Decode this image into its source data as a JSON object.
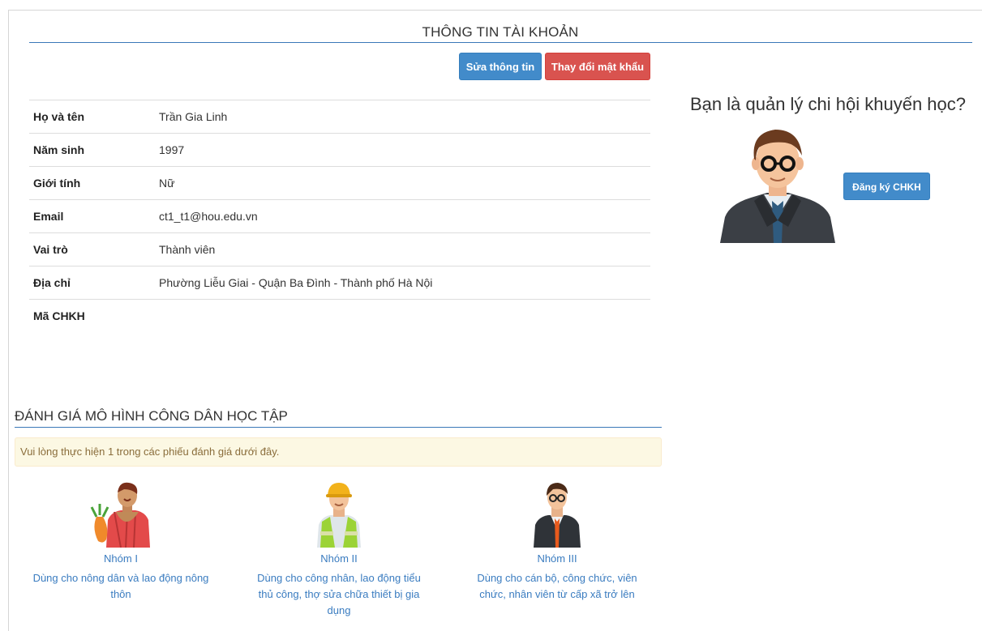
{
  "account": {
    "title": "THÔNG TIN TÀI KHOẢN",
    "edit_button": "Sửa thông tin",
    "change_password_button": "Thay đổi mật khẩu",
    "fields": [
      {
        "label": "Họ và tên",
        "value": "Trần Gia Linh"
      },
      {
        "label": "Năm sinh",
        "value": "1997"
      },
      {
        "label": "Giới tính",
        "value": "Nữ"
      },
      {
        "label": "Email",
        "value": "ct1_t1@hou.edu.vn"
      },
      {
        "label": "Vai trò",
        "value": "Thành viên"
      },
      {
        "label": "Địa chỉ",
        "value": "Phường Liễu Giai - Quận Ba Đình - Thành phố Hà Nội"
      },
      {
        "label": "Mã CHKH",
        "value": ""
      }
    ]
  },
  "sidebar": {
    "question": "Bạn là quản lý chi hội khuyến học?",
    "register_button": "Đăng ký CHKH"
  },
  "evaluation": {
    "title": "ĐÁNH GIÁ MÔ HÌNH CÔNG DÂN HỌC TẬP",
    "notice": "Vui lòng thực hiện 1 trong các phiếu đánh giá dưới đây.",
    "groups": [
      {
        "name": "Nhóm I",
        "line1": "Dùng cho nông dân và lao động nông",
        "line2": "thôn",
        "line3": "",
        "icon": "farmer-icon"
      },
      {
        "name": "Nhóm II",
        "line1": "Dùng cho công nhân, lao động tiểu",
        "line2": "thủ công, thợ sửa chữa thiết bị gia",
        "line3": "dụng",
        "icon": "worker-icon"
      },
      {
        "name": "Nhóm III",
        "line1": "Dùng cho cán bộ, công chức, viên",
        "line2": "chức, nhân viên từ cấp xã trở lên",
        "line3": "",
        "icon": "officer-icon"
      }
    ]
  },
  "colors": {
    "primary": "#428bca",
    "danger": "#d9534f",
    "link": "#3a7cc0",
    "rule": "#3a78b8",
    "alert_bg": "#fcf8e3"
  }
}
